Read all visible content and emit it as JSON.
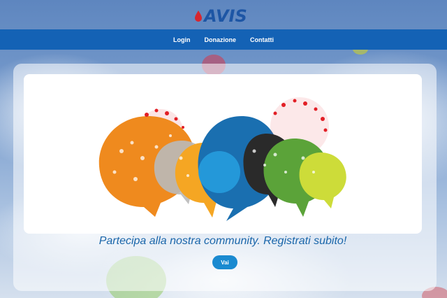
{
  "brand": {
    "logo_text": "AVIS",
    "logo_color": "#1d56a5",
    "drop_color": "#d7262f"
  },
  "nav": {
    "background": "#1462b5",
    "items": [
      {
        "label": "Login"
      },
      {
        "label": "Donazione"
      },
      {
        "label": "Contatti"
      }
    ]
  },
  "hero": {
    "illustration": "speech-bubbles-community-illustration",
    "bubble_colors": [
      "#ef8a1e",
      "#b9b9b9",
      "#f5a623",
      "#1a6fb0",
      "#2a2a2a",
      "#5ba339",
      "#cddc39",
      "#e21f26"
    ],
    "tagline": "Partecipa alla nostra community. Registrati subito!",
    "cta_label": "Vai",
    "cta_color": "#1a8ad0"
  }
}
